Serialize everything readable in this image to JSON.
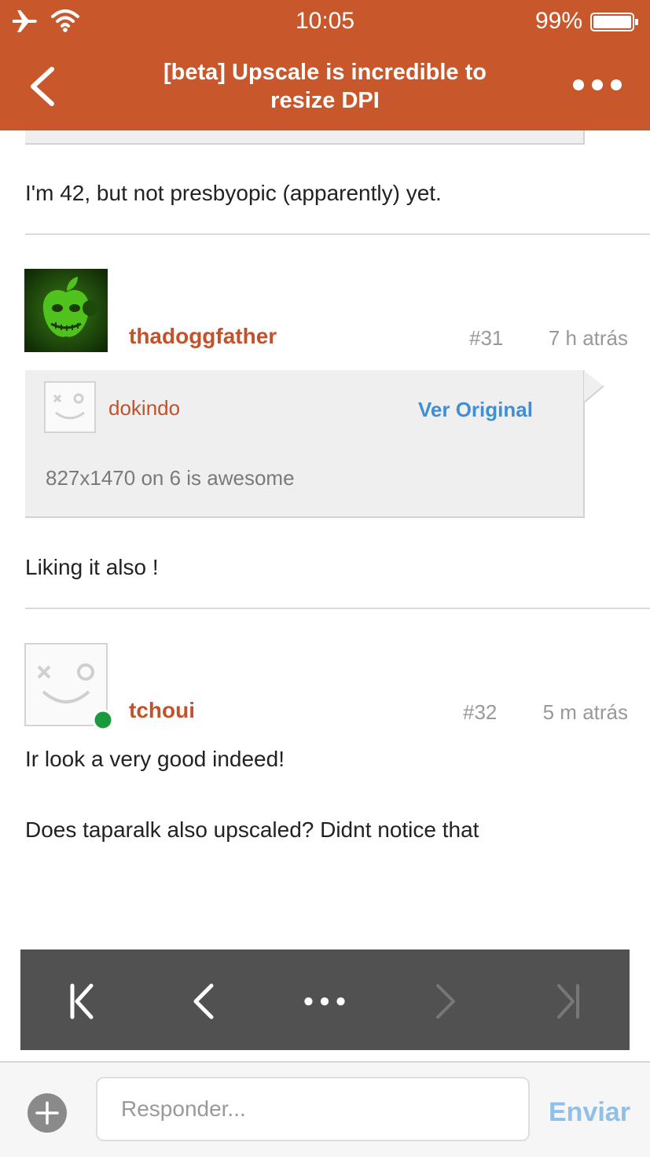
{
  "status_bar": {
    "time": "10:05",
    "battery_percent": "99%"
  },
  "nav": {
    "title_line1": "[beta] Upscale is incredible to",
    "title_line2": "resize DPI"
  },
  "posts": [
    {
      "body": "I'm 42, but not presbyopic (apparently) yet."
    },
    {
      "username": "thadoggfather",
      "number": "#31",
      "time": "7 h atrás",
      "quote": {
        "username": "dokindo",
        "link": "Ver Original",
        "text": "827x1470 on 6 is awesome"
      },
      "body": "Liking it also !"
    },
    {
      "username": "tchoui",
      "number": "#32",
      "time": "5 m atrás",
      "body_line1": "Ir look a very good indeed!",
      "body_line2": "Does taparalk also upscaled? Didnt notice that"
    }
  ],
  "reply": {
    "placeholder": "Responder...",
    "send_label": "Enviar"
  },
  "colors": {
    "header": "#c8582c",
    "username": "#c2522b",
    "link": "#3f8fd6",
    "send": "#8fc0ea",
    "pager": "#515151",
    "online": "#1a9a3c"
  }
}
